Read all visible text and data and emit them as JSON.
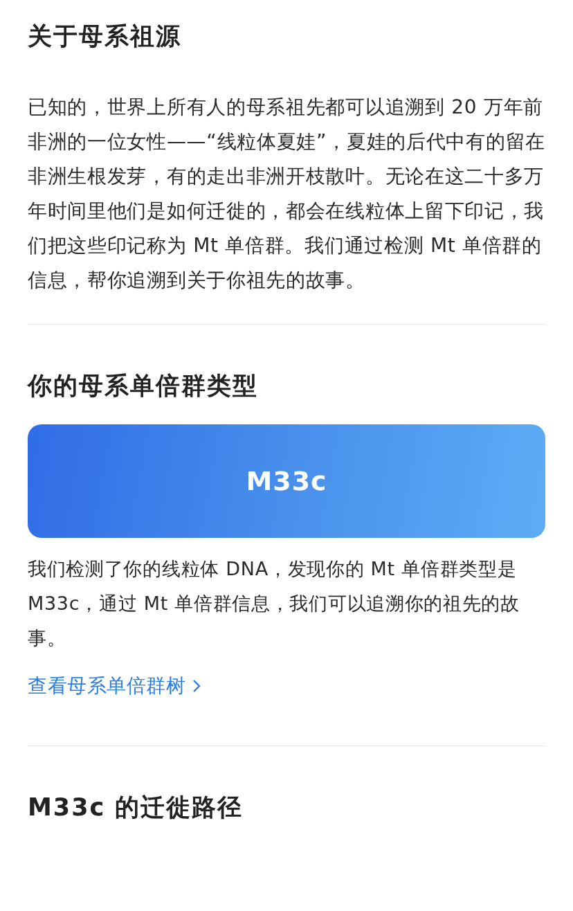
{
  "sections": [
    {
      "kind": "intro",
      "title": "关于母系祖源",
      "paragraph": "已知的，世界上所有人的母系祖先都可以追溯到 20 万年前非洲的一位女性——“线粒体夏娃”，夏娃的后代中有的留在非洲生根发芽，有的走出非洲开枝散叶。无论在这二十多万年时间里他们是如何迁徙的，都会在线粒体上留下印记，我们把这些印记称为 Mt 单倍群。我们通过检测 Mt 单倍群的信息，帮你追溯到关于你祖先的故事。"
    },
    {
      "kind": "haplogroup",
      "title": "你的母系单倍群类型",
      "card": "M33c",
      "paragraph": "我们检测了你的线粒体 DNA，发现你的 Mt 单倍群类型是 M33c，通过 Mt 单倍群信息，我们可以追溯你的祖先的故事。",
      "link": "查看母系单倍群树"
    },
    {
      "kind": "heading",
      "title": "M33c 的迁徙路径"
    }
  ]
}
